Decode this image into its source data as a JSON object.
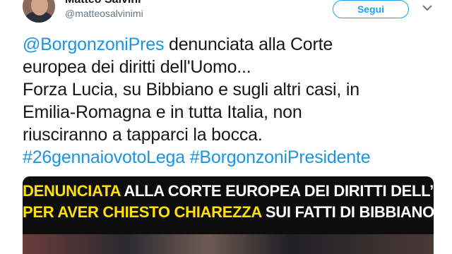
{
  "header": {
    "display_name": "Matteo Salvini",
    "handle": "@matteosalvinimi",
    "follow_label": "Segui"
  },
  "tweet": {
    "line1_mention": "@BorgonzoniPres",
    "line1_text": " denunciata alla Corte",
    "line2": "europea dei diritti dell'Uomo...",
    "line3": "Forza Lucia, su Bibbiano e sugli altri casi, in",
    "line4": "Emilia-Romagna e in tutta Italia, non",
    "line5": "riusciranno a tapparci la bocca.",
    "hashtag1": "#26gennaiovotoLega",
    "hashtag2": "#BorgonzoniPresidente"
  },
  "media": {
    "caption1_yellow": "DENUNCIATA",
    "caption1_white": " ALLA CORTE EUROPEA DEI DIRITTI DELL’UOMO",
    "caption2_yellow": "PER AVER CHIESTO CHIAREZZA",
    "caption2_white": " SUI FATTI DI BIBBIANO"
  },
  "icons": {
    "menu": "chevron-down-icon",
    "verified": "verified-badge-icon"
  },
  "colors": {
    "link": "#1b95e0",
    "follow": "#1da1f2",
    "caption_yellow": "#ffe000"
  }
}
